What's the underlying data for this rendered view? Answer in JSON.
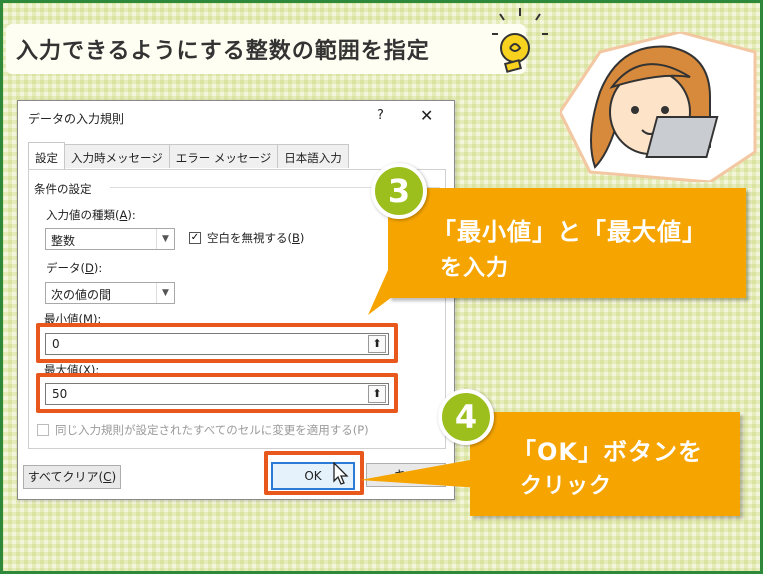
{
  "banner": {
    "title": "入力できるようにする整数の範囲を指定"
  },
  "dialog": {
    "title": "データの入力規則",
    "help": "?",
    "close": "✕",
    "tabs": [
      "設定",
      "入力時メッセージ",
      "エラー メッセージ",
      "日本語入力"
    ],
    "conditions_heading": "条件の設定",
    "allow_label": "入力値の種類(",
    "allow_key": "A",
    "allow_suffix": "):",
    "allow_value": "整数",
    "ignore_blank_label": "空白を無視する(",
    "ignore_blank_key": "B",
    "ignore_blank_suffix": ")",
    "ignore_blank_checked": "✓",
    "data_label": "データ(",
    "data_key": "D",
    "data_suffix": "):",
    "data_value": "次の値の間",
    "min_label": "最小値(",
    "min_key": "M",
    "min_suffix": "):",
    "min_value": "0",
    "max_label": "最大値(",
    "max_key": "X",
    "max_suffix": "):",
    "max_value": "50",
    "apply_all": "同じ入力規則が設定されたすべてのセルに変更を適用する(P)",
    "clear_all_label": "すべてクリア(",
    "clear_all_key": "C",
    "clear_all_suffix": ")",
    "ok": "OK",
    "cancel": "キャ"
  },
  "callout3": {
    "number": "3",
    "line1": "「最小値」と「最大値」",
    "line2": "を入力"
  },
  "callout4": {
    "number": "4",
    "line1": "「OK」ボタンを",
    "line2": "クリック"
  },
  "colors": {
    "accent": "#f5a400",
    "highlight": "#e8581c",
    "badge": "#9cbf1e",
    "frame": "#2e8a3a"
  }
}
